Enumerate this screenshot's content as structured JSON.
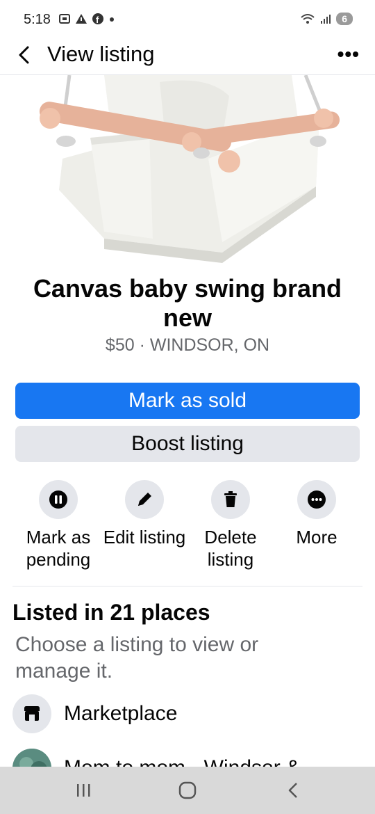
{
  "status_bar": {
    "time": "5:18",
    "battery": "6"
  },
  "header": {
    "title": "View listing",
    "more": "•••"
  },
  "listing": {
    "title": "Canvas baby swing brand new",
    "subtitle": "$50 · WINDSOR, ON"
  },
  "buttons": {
    "mark_sold": "Mark as sold",
    "boost": "Boost listing"
  },
  "actions": [
    {
      "label": "Mark as pending",
      "icon": "pause-icon"
    },
    {
      "label": "Edit listing",
      "icon": "pencil-icon"
    },
    {
      "label": "Delete listing",
      "icon": "trash-icon"
    },
    {
      "label": "More",
      "icon": "more-icon"
    }
  ],
  "places": {
    "title": "Listed in 21 places",
    "subtitle": "Choose a listing to view or manage it.",
    "items": [
      {
        "label": "Marketplace",
        "icon": "shop-icon"
      },
      {
        "label": "Mom to mom - Windsor &",
        "icon": "group-avatar"
      }
    ]
  },
  "colors": {
    "primary": "#1877f2",
    "secondary_bg": "#e4e6eb",
    "muted_text": "#65676b",
    "nav_bar": "#d9d9d9"
  }
}
